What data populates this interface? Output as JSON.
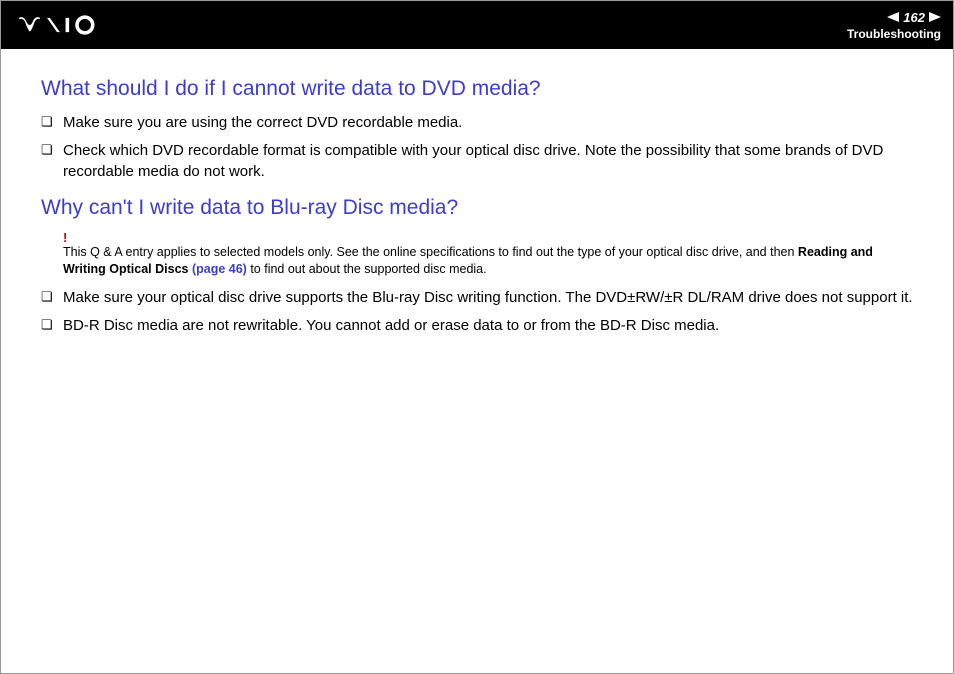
{
  "header": {
    "page_number": "162",
    "breadcrumb": "Troubleshooting"
  },
  "section1": {
    "heading": "What should I do if I cannot write data to DVD media?",
    "bullets": [
      "Make sure you are using the correct DVD recordable media.",
      "Check which DVD recordable format is compatible with your optical disc drive. Note the possibility that some brands of DVD recordable media do not work."
    ]
  },
  "section2": {
    "heading": "Why can't I write data to Blu-ray Disc media?",
    "note": {
      "mark": "!",
      "text_before": "This Q & A entry applies to selected models only. See the online specifications to find out the type of your optical disc drive, and then ",
      "bold": "Reading and Writing Optical Discs ",
      "link": "(page 46)",
      "text_after": " to find out about the supported disc media."
    },
    "bullets": [
      "Make sure your optical disc drive supports the Blu-ray Disc writing function. The DVD±RW/±R DL/RAM drive does not support it.",
      "BD-R Disc media are not rewritable. You cannot add or erase data to or from the BD-R Disc media."
    ]
  }
}
